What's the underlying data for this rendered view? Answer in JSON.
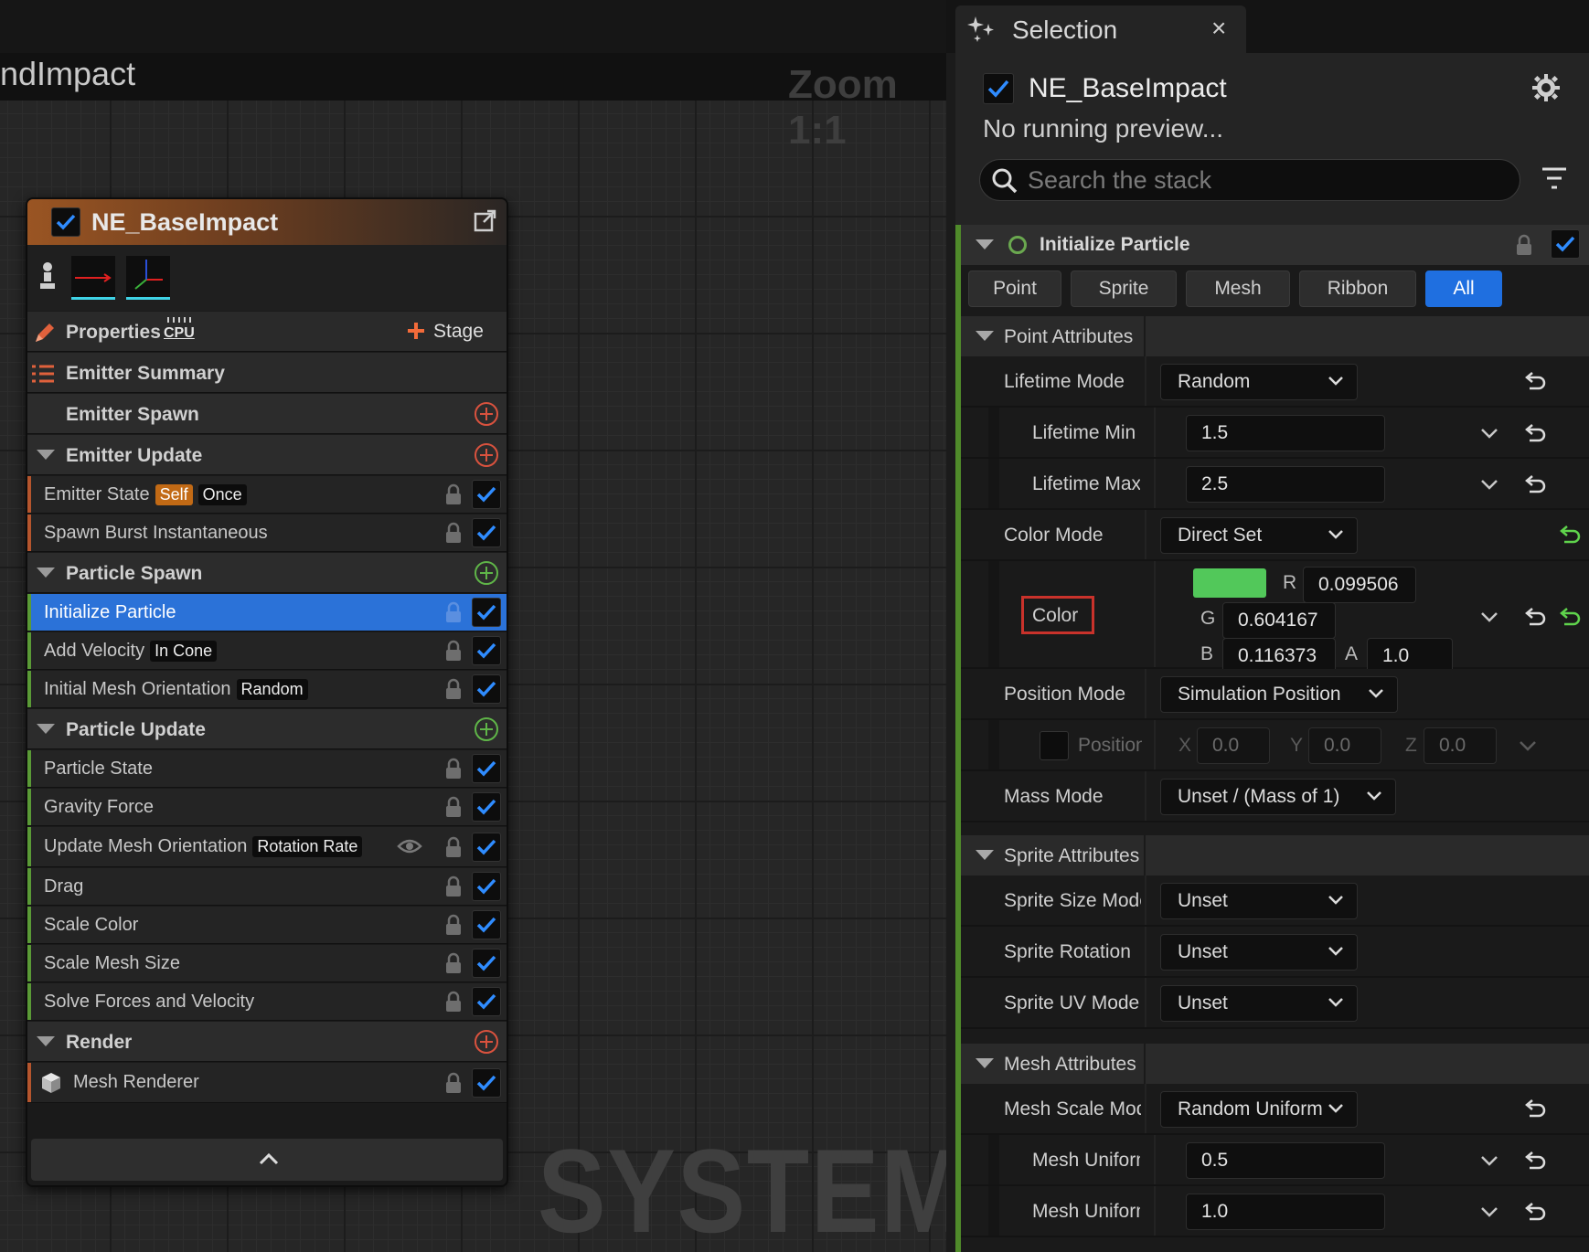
{
  "graph": {
    "title": "ndImpact",
    "zoom": "Zoom 1:1",
    "watermark": "SYSTEM"
  },
  "node": {
    "title": "NE_BaseImpact",
    "properties_label": "Properties",
    "cpu_badge": "CPU",
    "stage_label": "Stage",
    "emitter_summary_label": "Emitter Summary",
    "sections": [
      {
        "label": "Emitter Spawn",
        "plus_color": "#d9523e"
      },
      {
        "label": "Emitter Update",
        "plus_color": "#d9523e"
      },
      {
        "label": "Particle Spawn",
        "plus_color": "#5fb548"
      },
      {
        "label": "Particle Update",
        "plus_color": "#5fb548"
      },
      {
        "label": "Render",
        "plus_color": "#d9523e"
      }
    ],
    "modules": {
      "emitter_state": {
        "label": "Emitter State",
        "tag1": "Self",
        "tag2": "Once"
      },
      "spawn_burst": {
        "label": "Spawn Burst Instantaneous"
      },
      "initialize_particle": {
        "label": "Initialize Particle"
      },
      "add_velocity": {
        "label": "Add Velocity",
        "tag": "In Cone"
      },
      "initial_mesh_orientation": {
        "label": "Initial Mesh Orientation",
        "tag": "Random"
      },
      "particle_state": {
        "label": "Particle State"
      },
      "gravity_force": {
        "label": "Gravity Force"
      },
      "update_mesh_orientation": {
        "label": "Update Mesh Orientation",
        "tag": "Rotation Rate"
      },
      "drag": {
        "label": "Drag"
      },
      "scale_color": {
        "label": "Scale Color"
      },
      "scale_mesh_size": {
        "label": "Scale Mesh Size"
      },
      "solve_forces": {
        "label": "Solve Forces and Velocity"
      },
      "mesh_renderer": {
        "label": "Mesh Renderer"
      }
    }
  },
  "panel": {
    "tab_label": "Selection",
    "tab_close": "×",
    "emitter_name": "NE_BaseImpact",
    "preview_status": "No running preview...",
    "search_placeholder": "Search the stack",
    "module_title": "Initialize Particle",
    "filter_tabs": [
      "Point",
      "Sprite",
      "Mesh",
      "Ribbon",
      "All"
    ],
    "active_filter": "All",
    "point_attributes": {
      "label": "Point Attributes",
      "lifetime_mode": {
        "label": "Lifetime Mode",
        "value": "Random"
      },
      "lifetime_min": {
        "label": "Lifetime Min",
        "value": "1.5"
      },
      "lifetime_max": {
        "label": "Lifetime Max",
        "value": "2.5"
      },
      "color_mode": {
        "label": "Color Mode",
        "value": "Direct Set"
      },
      "color": {
        "label": "Color",
        "swatch": "#52c85a",
        "r_label": "R",
        "r": "0.099506",
        "g_label": "G",
        "g": "0.604167",
        "b_label": "B",
        "b": "0.116373",
        "a_label": "A",
        "a": "1.0"
      },
      "position_mode": {
        "label": "Position Mode",
        "value": "Simulation Position"
      },
      "position": {
        "label": "Position",
        "x_label": "X",
        "x": "0.0",
        "y_label": "Y",
        "y": "0.0",
        "z_label": "Z",
        "z": "0.0"
      },
      "mass_mode": {
        "label": "Mass Mode",
        "value": "Unset / (Mass of 1)"
      }
    },
    "sprite_attributes": {
      "label": "Sprite Attributes",
      "size_mode": {
        "label": "Sprite Size Mode",
        "value": "Unset"
      },
      "rotation": {
        "label": "Sprite Rotation",
        "value": "Unset"
      },
      "uv_mode": {
        "label": "Sprite UV Mode",
        "value": "Unset"
      }
    },
    "mesh_attributes": {
      "label": "Mesh Attributes",
      "scale_mode": {
        "label": "Mesh Scale Mode",
        "value": "Random Uniform"
      },
      "uniform_min": {
        "label": "Mesh Uniform Min",
        "value": "0.5"
      },
      "uniform_max": {
        "label": "Mesh Uniform Max",
        "value": "1.0"
      }
    }
  },
  "colors": {
    "accent_blue": "#2b72d8",
    "module_green": "#6aa84f",
    "reset_green": "#5fd34c",
    "emitter_orange": "#9a5523"
  }
}
